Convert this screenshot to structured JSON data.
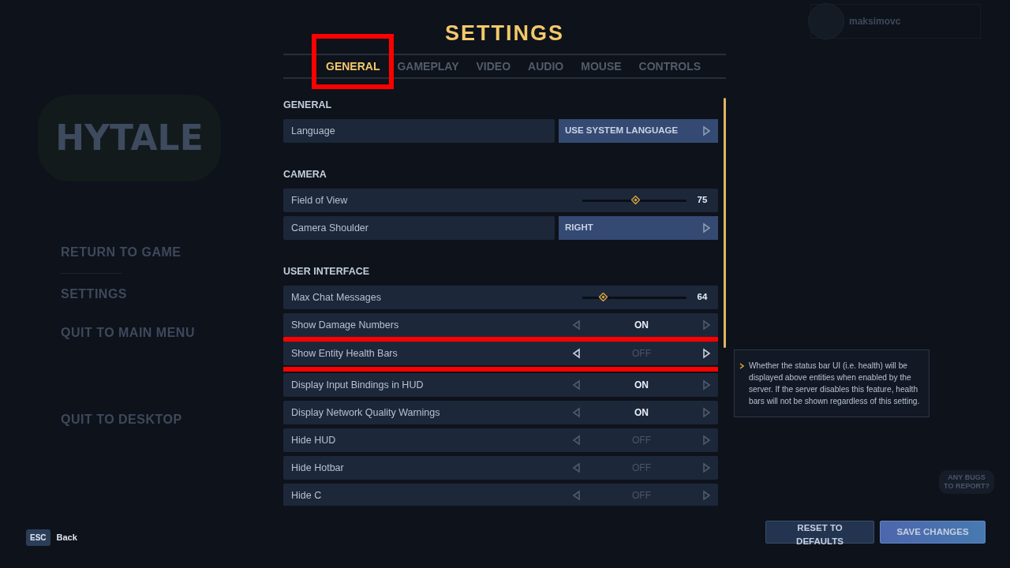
{
  "background_menu": {
    "logo": "HYTALE",
    "items": [
      "RETURN TO GAME",
      "SETTINGS",
      "QUIT TO MAIN MENU",
      "QUIT TO DESKTOP"
    ],
    "back_key": "ESC",
    "back_label": "Back"
  },
  "profile": {
    "username": "maksimovc"
  },
  "title": "SETTINGS",
  "tabs": [
    {
      "label": "GENERAL",
      "selected": true,
      "highlighted": true
    },
    {
      "label": "GAMEPLAY",
      "selected": false,
      "highlighted": false
    },
    {
      "label": "VIDEO",
      "selected": false,
      "highlighted": false
    },
    {
      "label": "AUDIO",
      "selected": false,
      "highlighted": false
    },
    {
      "label": "MOUSE",
      "selected": false,
      "highlighted": false
    },
    {
      "label": "CONTROLS",
      "selected": false,
      "highlighted": false
    }
  ],
  "sections": [
    {
      "title": "GENERAL",
      "settings": [
        {
          "kind": "select",
          "label": "Language",
          "value": "USE SYSTEM LANGUAGE"
        }
      ]
    },
    {
      "title": "CAMERA",
      "settings": [
        {
          "kind": "slider",
          "label": "Field of View",
          "level": 0.51,
          "reading": "75"
        },
        {
          "kind": "select",
          "label": "Camera Shoulder",
          "value": "RIGHT"
        }
      ]
    },
    {
      "title": "USER INTERFACE",
      "settings": [
        {
          "kind": "slider",
          "label": "Max Chat Messages",
          "level": 0.2,
          "reading": "64"
        },
        {
          "kind": "toggle",
          "label": "Show Damage Numbers",
          "value": "ON",
          "on": true,
          "hovered": false,
          "highlighted": false
        },
        {
          "kind": "toggle",
          "label": "Show Entity Health Bars",
          "value": "OFF",
          "on": false,
          "hovered": true,
          "highlighted": true
        },
        {
          "kind": "toggle",
          "label": "Display Input Bindings in HUD",
          "value": "ON",
          "on": true,
          "hovered": false,
          "highlighted": false
        },
        {
          "kind": "toggle",
          "label": "Display Network Quality Warnings",
          "value": "ON",
          "on": true,
          "hovered": false,
          "highlighted": false
        },
        {
          "kind": "toggle",
          "label": "Hide HUD",
          "value": "OFF",
          "on": false,
          "hovered": false,
          "highlighted": false
        },
        {
          "kind": "toggle",
          "label": "Hide Hotbar",
          "value": "OFF",
          "on": false,
          "hovered": false,
          "highlighted": false
        },
        {
          "kind": "toggle",
          "label": "Hide C",
          "value": "OFF",
          "on": false,
          "hovered": false,
          "highlighted": false
        }
      ]
    }
  ],
  "tooltip": "Whether the status bar UI (i.e. health) will be displayed above entities when enabled by the server. If the server disables this feature, health bars will not be shown regardless of this setting.",
  "mascot_bubble": "ANY BUGS TO REPORT?",
  "buttons": [
    {
      "label": "RESET TO DEFAULTS",
      "kind": "secondary"
    },
    {
      "label": "SAVE CHANGES",
      "kind": "primary"
    }
  ]
}
